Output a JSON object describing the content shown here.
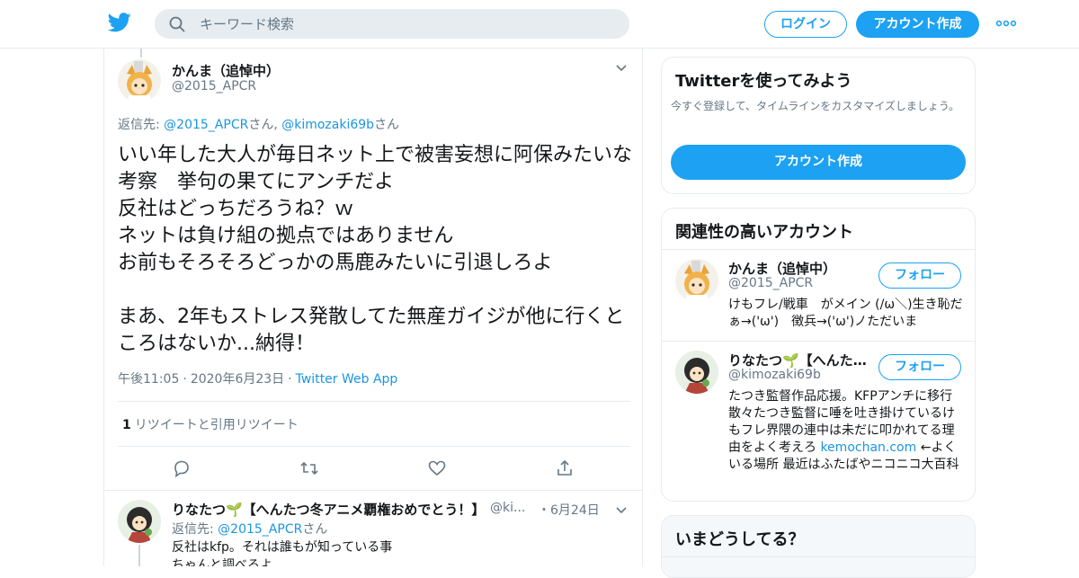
{
  "header": {
    "search_placeholder": "キーワード検索",
    "login_label": "ログイン",
    "signup_label": "アカウント作成",
    "brand_color": "#1da1f2"
  },
  "tweet": {
    "author_name": "かんま（追悼中）",
    "author_handle": "@2015_APCR",
    "reply_prefix": "返信先: ",
    "reply_mentions": [
      "@2015_APCR",
      "@kimozaki69b"
    ],
    "reply_suffix_1": "さん, ",
    "reply_suffix_2": "さん",
    "text": "いい年した大人が毎日ネット上で被害妄想に阿保みたいな考察　挙句の果てにアンチだよ\n反社はどっちだろうね？ｗ\nネットは負け組の拠点ではありません\nお前もそろそろどっかの馬鹿みたいに引退しろよ\n\nまあ、2年もストレス発散してた無産ガイジが他に行くところはないか...納得！",
    "time": "午後11:05",
    "date": "2020年6月23日",
    "source": "Twitter Web App",
    "retweet_count": "1",
    "retweet_label": "リツイートと引用リツイート"
  },
  "reply": {
    "author_name": "りなたつ🌱【へんたつ冬アニメ覇権おめでとう！】",
    "author_handle": "@ki...",
    "date": "・6月24日",
    "reply_prefix": "返信先: ",
    "reply_mention": "@2015_APCR",
    "reply_suffix": "さん",
    "text": "反社はkfp。それは誰もが知っている事\nちゃんと調べろよ"
  },
  "sidebar": {
    "signup_card": {
      "title": "Twitterを使ってみよう",
      "desc": "今すぐ登録して、タイムラインをカスタマイズしましょう。",
      "cta": "アカウント作成"
    },
    "related": {
      "title": "関連性の高いアカウント",
      "accounts": [
        {
          "name": "かんま（追悼中）",
          "handle": "@2015_APCR",
          "follow_label": "フォロー",
          "bio": "けもフレ/戦車　がメイン (/ω＼)生き恥だぁ→('ω')　徴兵→('ω')ノただいま"
        },
        {
          "name": "りなたつ🌱【へんたつ冬アニメ覇権おめでとう！】",
          "handle": "@kimozaki69b",
          "follow_label": "フォロー",
          "bio_pre": "たつき監督作品応援。KFPアンチに移行 散々たつき監督に唾を吐き掛けているけもフレ界隈の連中は未だに叩かれてる理由をよく考えろ ",
          "bio_link": "kemochan.com",
          "bio_post": " ←よくいる場所 最近はふたばやニコニコ大百科"
        }
      ]
    },
    "whats_happening": {
      "title": "いまどうしてる？"
    }
  }
}
